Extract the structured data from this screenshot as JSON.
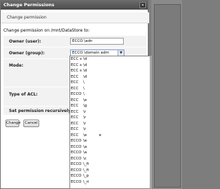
{
  "dialog": {
    "title": "Change Permissions",
    "section_header": "Change permission",
    "description": "Change permission on /mnt/DataStore to:",
    "fields": {
      "owner_user_label": "Owner (user):",
      "owner_user_value": "ECCO   \\adn",
      "owner_group_label": "Owner (group):",
      "owner_group_value": "ECCO   \\domain adm",
      "mode_label": "Mode:",
      "acl_label": "Type of ACL:",
      "recursive_label": "Set permission recursively:"
    },
    "buttons": {
      "change": "Change",
      "cancel": "Cancel"
    }
  },
  "dropdown": {
    "items": [
      {
        "prefix": "ECC",
        "suffix": "\\d",
        "tail": "s"
      },
      {
        "prefix": "ECC",
        "suffix": "\\d",
        "tail": "s"
      },
      {
        "prefix": "ECC",
        "suffix": "\\d",
        "tail": "s"
      },
      {
        "prefix": "ECC",
        "suffix": "\\d",
        "tail": ""
      },
      {
        "prefix": "ECC",
        "suffix": "\\",
        "tail": ""
      },
      {
        "prefix": "ECC",
        "suffix": "\\",
        "tail": ""
      },
      {
        "prefix": "ECCO",
        "suffix": "\\",
        "tail": ""
      },
      {
        "prefix": "ECC",
        "suffix": "\\e",
        "tail": ""
      },
      {
        "prefix": "ECC",
        "suffix": "\\g",
        "tail": ""
      },
      {
        "prefix": "ECC",
        "suffix": "\\r",
        "tail": ""
      },
      {
        "prefix": "ECC",
        "suffix": "\\r",
        "tail": ""
      },
      {
        "prefix": "ECC",
        "suffix": "\\r",
        "tail": ""
      },
      {
        "prefix": "ECC",
        "suffix": "\\r",
        "tail": ""
      },
      {
        "prefix": "ECC",
        "suffix": "\\e",
        "tail": "e"
      },
      {
        "prefix": "ECCO",
        "suffix": "\\e",
        "tail": ""
      },
      {
        "prefix": "ECCO",
        "suffix": "\\a",
        "tail": ""
      },
      {
        "prefix": "ECCO",
        "suffix": "\\a",
        "tail": ""
      },
      {
        "prefix": "ECCO",
        "suffix": "\\c",
        "tail": ""
      },
      {
        "prefix": "ECCO",
        "suffix": "\\_fi",
        "tail": ""
      },
      {
        "prefix": "ECCO",
        "suffix": "\\_fi",
        "tail": ""
      },
      {
        "prefix": "ECCO",
        "suffix": "\\_p",
        "tail": ""
      },
      {
        "prefix": "ECCO",
        "suffix": "\\_ri",
        "tail": ""
      }
    ]
  }
}
